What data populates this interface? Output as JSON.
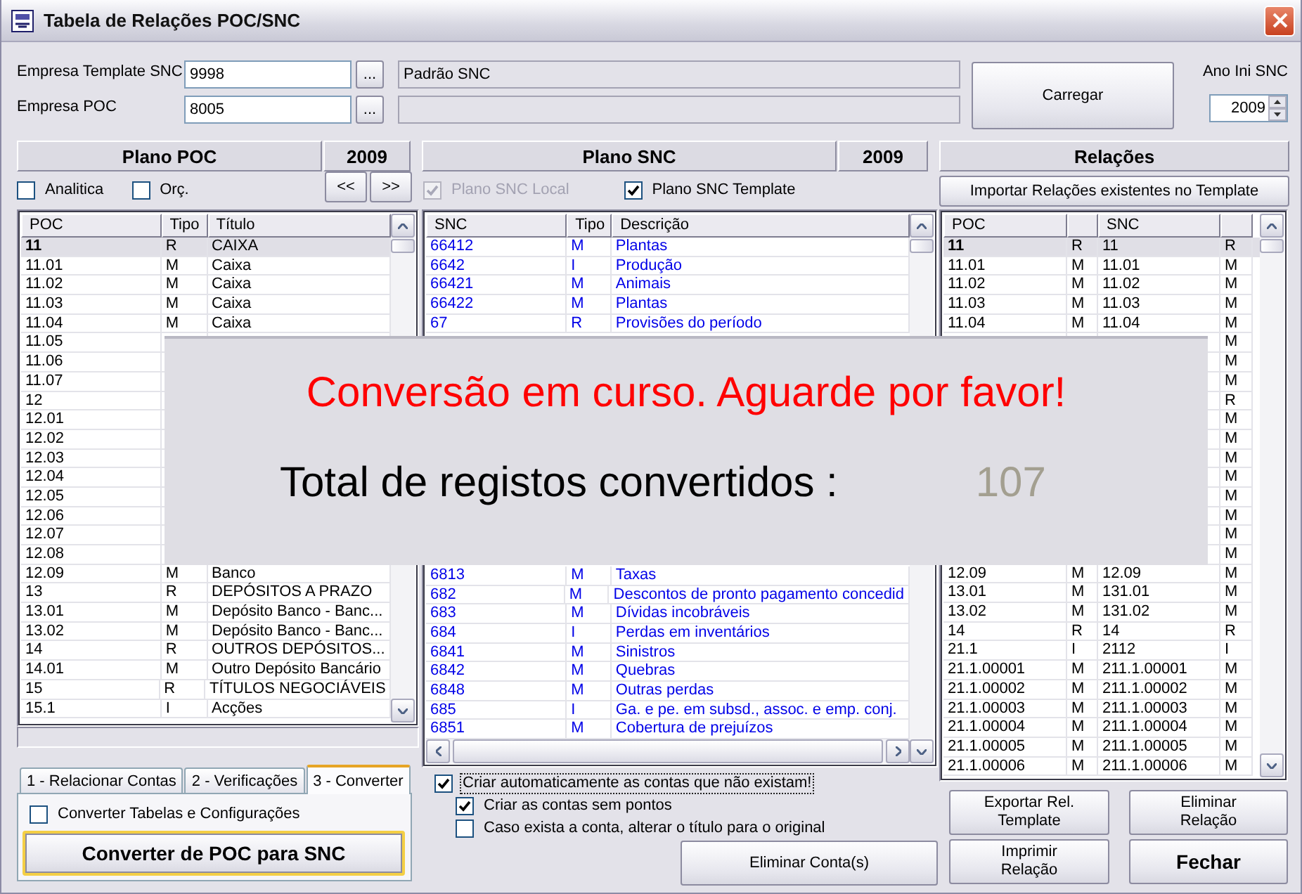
{
  "window": {
    "title": "Tabela de Relações POC/SNC"
  },
  "empresa_template_snc": {
    "label": "Empresa Template SNC",
    "value": "9998",
    "browse": "...",
    "description": "Padrão SNC"
  },
  "empresa_poc": {
    "label": "Empresa POC",
    "value": "8005",
    "browse": "..."
  },
  "load_button": "Carregar",
  "ano_ini_snc": {
    "label": "Ano Ini SNC",
    "value": "2009"
  },
  "plano_poc": {
    "title": "Plano POC",
    "year": "2009",
    "options": [
      {
        "label": "Analitica",
        "checked": false
      },
      {
        "label": "Orç.",
        "checked": false
      }
    ],
    "nav_buttons": [
      "<<",
      ">>"
    ],
    "table": {
      "columns": [
        {
          "kind": "text",
          "label": "POC"
        },
        {
          "kind": "text",
          "label": "Tipo"
        },
        {
          "kind": "text",
          "label": "Título"
        }
      ],
      "rows": [
        {
          "poc": "11",
          "tipo": "R",
          "titulo": "CAIXA",
          "selected": true
        },
        {
          "poc": "11.01",
          "tipo": "M",
          "titulo": "Caixa",
          "selected": false
        },
        {
          "poc": "11.02",
          "tipo": "M",
          "titulo": "Caixa",
          "selected": false
        },
        {
          "poc": "11.03",
          "tipo": "M",
          "titulo": "Caixa",
          "selected": false
        },
        {
          "poc": "11.04",
          "tipo": "M",
          "titulo": "Caixa",
          "selected": false
        },
        {
          "poc": "11.05",
          "selected": false
        },
        {
          "poc": "11.06",
          "selected": false
        },
        {
          "poc": "11.07",
          "selected": false
        },
        {
          "poc": "12",
          "selected": false
        },
        {
          "poc": "12.01",
          "selected": false
        },
        {
          "poc": "12.02",
          "selected": false
        },
        {
          "poc": "12.03",
          "selected": false
        },
        {
          "poc": "12.04",
          "selected": false
        },
        {
          "poc": "12.05",
          "selected": false
        },
        {
          "poc": "12.06",
          "selected": false
        },
        {
          "poc": "12.07",
          "selected": false
        },
        {
          "poc": "12.08",
          "selected": false
        },
        {
          "poc": "12.09",
          "tipo": "M",
          "titulo": "Banco",
          "selected": false
        },
        {
          "poc": "13",
          "tipo": "R",
          "titulo": "DEPÓSITOS A PRAZO",
          "selected": false
        },
        {
          "poc": "13.01",
          "tipo": "M",
          "titulo": "Depósito Banco - Banc...",
          "selected": false
        },
        {
          "poc": "13.02",
          "tipo": "M",
          "titulo": "Depósito Banco - Banc...",
          "selected": false
        },
        {
          "poc": "14",
          "tipo": "R",
          "titulo": "OUTROS DEPÓSITOS...",
          "selected": false
        },
        {
          "poc": "14.01",
          "tipo": "M",
          "titulo": "Outro Depósito Bancário",
          "selected": false
        },
        {
          "poc": "15",
          "tipo": "R",
          "titulo": "TÍTULOS NEGOCIÁVEIS",
          "selected": false
        },
        {
          "poc": "15.1",
          "tipo": "I",
          "titulo": "Acções",
          "selected": false
        }
      ]
    }
  },
  "plano_snc": {
    "title": "Plano SNC",
    "year": "2009",
    "options": [
      {
        "label": "Plano SNC Local",
        "checked": true,
        "disabled": true
      },
      {
        "label": "Plano SNC Template",
        "checked": true,
        "disabled": false
      }
    ],
    "table": {
      "columns": [
        {
          "kind": "text",
          "label": "SNC"
        },
        {
          "kind": "text",
          "label": "Tipo"
        },
        {
          "kind": "text",
          "label": "Descrição"
        }
      ],
      "rows_top": [
        {
          "snc": "66412",
          "tipo": "M",
          "descricao": "Plantas"
        },
        {
          "snc": "6642",
          "tipo": "I",
          "descricao": "Produção"
        },
        {
          "snc": "66421",
          "tipo": "M",
          "descricao": "Animais"
        },
        {
          "snc": "66422",
          "tipo": "M",
          "descricao": "Plantas"
        },
        {
          "snc": "67",
          "tipo": "R",
          "descricao": "Provisões do período"
        }
      ],
      "rows_bottom": [
        {
          "snc": "6813",
          "tipo": "M",
          "descricao": "Taxas"
        },
        {
          "snc": "682",
          "tipo": "M",
          "descricao": "Descontos de pronto pagamento concedid"
        },
        {
          "snc": "683",
          "tipo": "M",
          "descricao": "Dívidas incobráveis"
        },
        {
          "snc": "684",
          "tipo": "I",
          "descricao": "Perdas em inventários"
        },
        {
          "snc": "6841",
          "tipo": "M",
          "descricao": "Sinistros"
        },
        {
          "snc": "6842",
          "tipo": "M",
          "descricao": "Quebras"
        },
        {
          "snc": "6848",
          "tipo": "M",
          "descricao": "Outras perdas"
        },
        {
          "snc": "685",
          "tipo": "I",
          "descricao": "Ga. e pe. em subsd., assoc. e emp. conj."
        },
        {
          "snc": "6851",
          "tipo": "M",
          "descricao": "Cobertura de prejuízos"
        }
      ]
    }
  },
  "relacoes": {
    "title": "Relações",
    "import_button": "Importar Relações existentes no Template",
    "table": {
      "columns": [
        {
          "kind": "text",
          "label": "POC"
        },
        {
          "kind": "blank"
        },
        {
          "kind": "text",
          "label": "SNC"
        },
        {
          "kind": "blank"
        }
      ],
      "rows": [
        {
          "poc": "11",
          "poc_tipo": "R",
          "snc": "11",
          "snc_tipo": "R",
          "selected": true
        },
        {
          "poc": "11.01",
          "poc_tipo": "M",
          "snc": "11.01",
          "snc_tipo": "M",
          "selected": false
        },
        {
          "poc": "11.02",
          "poc_tipo": "M",
          "snc": "11.02",
          "snc_tipo": "M",
          "selected": false
        },
        {
          "poc": "11.03",
          "poc_tipo": "M",
          "snc": "11.03",
          "snc_tipo": "M",
          "selected": false
        },
        {
          "poc": "11.04",
          "poc_tipo": "M",
          "snc": "11.04",
          "snc_tipo": "M",
          "selected": false
        },
        {
          "snc_tipo": "M",
          "selected": false
        },
        {
          "snc_tipo": "M",
          "selected": false
        },
        {
          "snc_tipo": "M",
          "selected": false
        },
        {
          "snc_tipo": "R",
          "selected": false
        },
        {
          "snc_tipo": "M",
          "selected": false
        },
        {
          "snc_tipo": "M",
          "selected": false
        },
        {
          "snc_tipo": "M",
          "selected": false
        },
        {
          "snc_tipo": "M",
          "selected": false
        },
        {
          "snc_tipo": "M",
          "selected": false
        },
        {
          "snc_tipo": "M",
          "selected": false
        },
        {
          "snc_tipo": "M",
          "selected": false
        },
        {
          "snc_tipo": "M",
          "selected": false
        },
        {
          "poc": "12.09",
          "poc_tipo": "M",
          "snc": "12.09",
          "snc_tipo": "M",
          "selected": false
        },
        {
          "poc": "13.01",
          "poc_tipo": "M",
          "snc": "131.01",
          "snc_tipo": "M",
          "selected": false
        },
        {
          "poc": "13.02",
          "poc_tipo": "M",
          "snc": "131.02",
          "snc_tipo": "M",
          "selected": false
        },
        {
          "poc": "14",
          "poc_tipo": "R",
          "snc": "14",
          "snc_tipo": "R",
          "selected": false
        },
        {
          "poc": "21.1",
          "poc_tipo": "I",
          "snc": "2112",
          "snc_tipo": "I",
          "selected": false
        },
        {
          "poc": "21.1.00001",
          "poc_tipo": "M",
          "snc": "211.1.00001",
          "snc_tipo": "M",
          "selected": false
        },
        {
          "poc": "21.1.00002",
          "poc_tipo": "M",
          "snc": "211.1.00002",
          "snc_tipo": "M",
          "selected": false
        },
        {
          "poc": "21.1.00003",
          "poc_tipo": "M",
          "snc": "211.1.00003",
          "snc_tipo": "M",
          "selected": false
        },
        {
          "poc": "21.1.00004",
          "poc_tipo": "M",
          "snc": "211.1.00004",
          "snc_tipo": "M",
          "selected": false
        },
        {
          "poc": "21.1.00005",
          "poc_tipo": "M",
          "snc": "211.1.00005",
          "snc_tipo": "M",
          "selected": false
        },
        {
          "poc": "21.1.00006",
          "poc_tipo": "M",
          "snc": "211.1.00006",
          "snc_tipo": "M",
          "selected": false
        }
      ]
    }
  },
  "tabs": [
    {
      "label": "1 - Relacionar Contas",
      "selected": false
    },
    {
      "label": "2 - Verificações",
      "selected": false
    },
    {
      "label": "3 - Converter",
      "selected": true
    }
  ],
  "convert_tab": {
    "option": {
      "label": "Converter Tabelas e Configurações",
      "checked": false
    },
    "button": "Converter de POC para SNC"
  },
  "create_options": [
    {
      "label": "Criar automaticamente as contas que não existam!",
      "checked": true,
      "focused": true,
      "children": [
        {
          "label": "Criar as contas sem pontos",
          "checked": true,
          "focused": false
        },
        {
          "label": "Caso exista a conta, alterar o título para o original",
          "checked": false,
          "focused": false
        }
      ]
    }
  ],
  "delete_accounts_button": "Eliminar Conta(s)",
  "relation_buttons": [
    {
      "label": "Exportar Rel. Template",
      "bold": false
    },
    {
      "label": "Eliminar Relação",
      "bold": false
    },
    {
      "label": "Imprimir Relação",
      "bold": false
    },
    {
      "label": "Fechar",
      "bold": true
    }
  ],
  "overlay": {
    "message": "Conversão em curso. Aguarde por favor!",
    "total_label": "Total de registos convertidos :",
    "total_value": "107"
  }
}
